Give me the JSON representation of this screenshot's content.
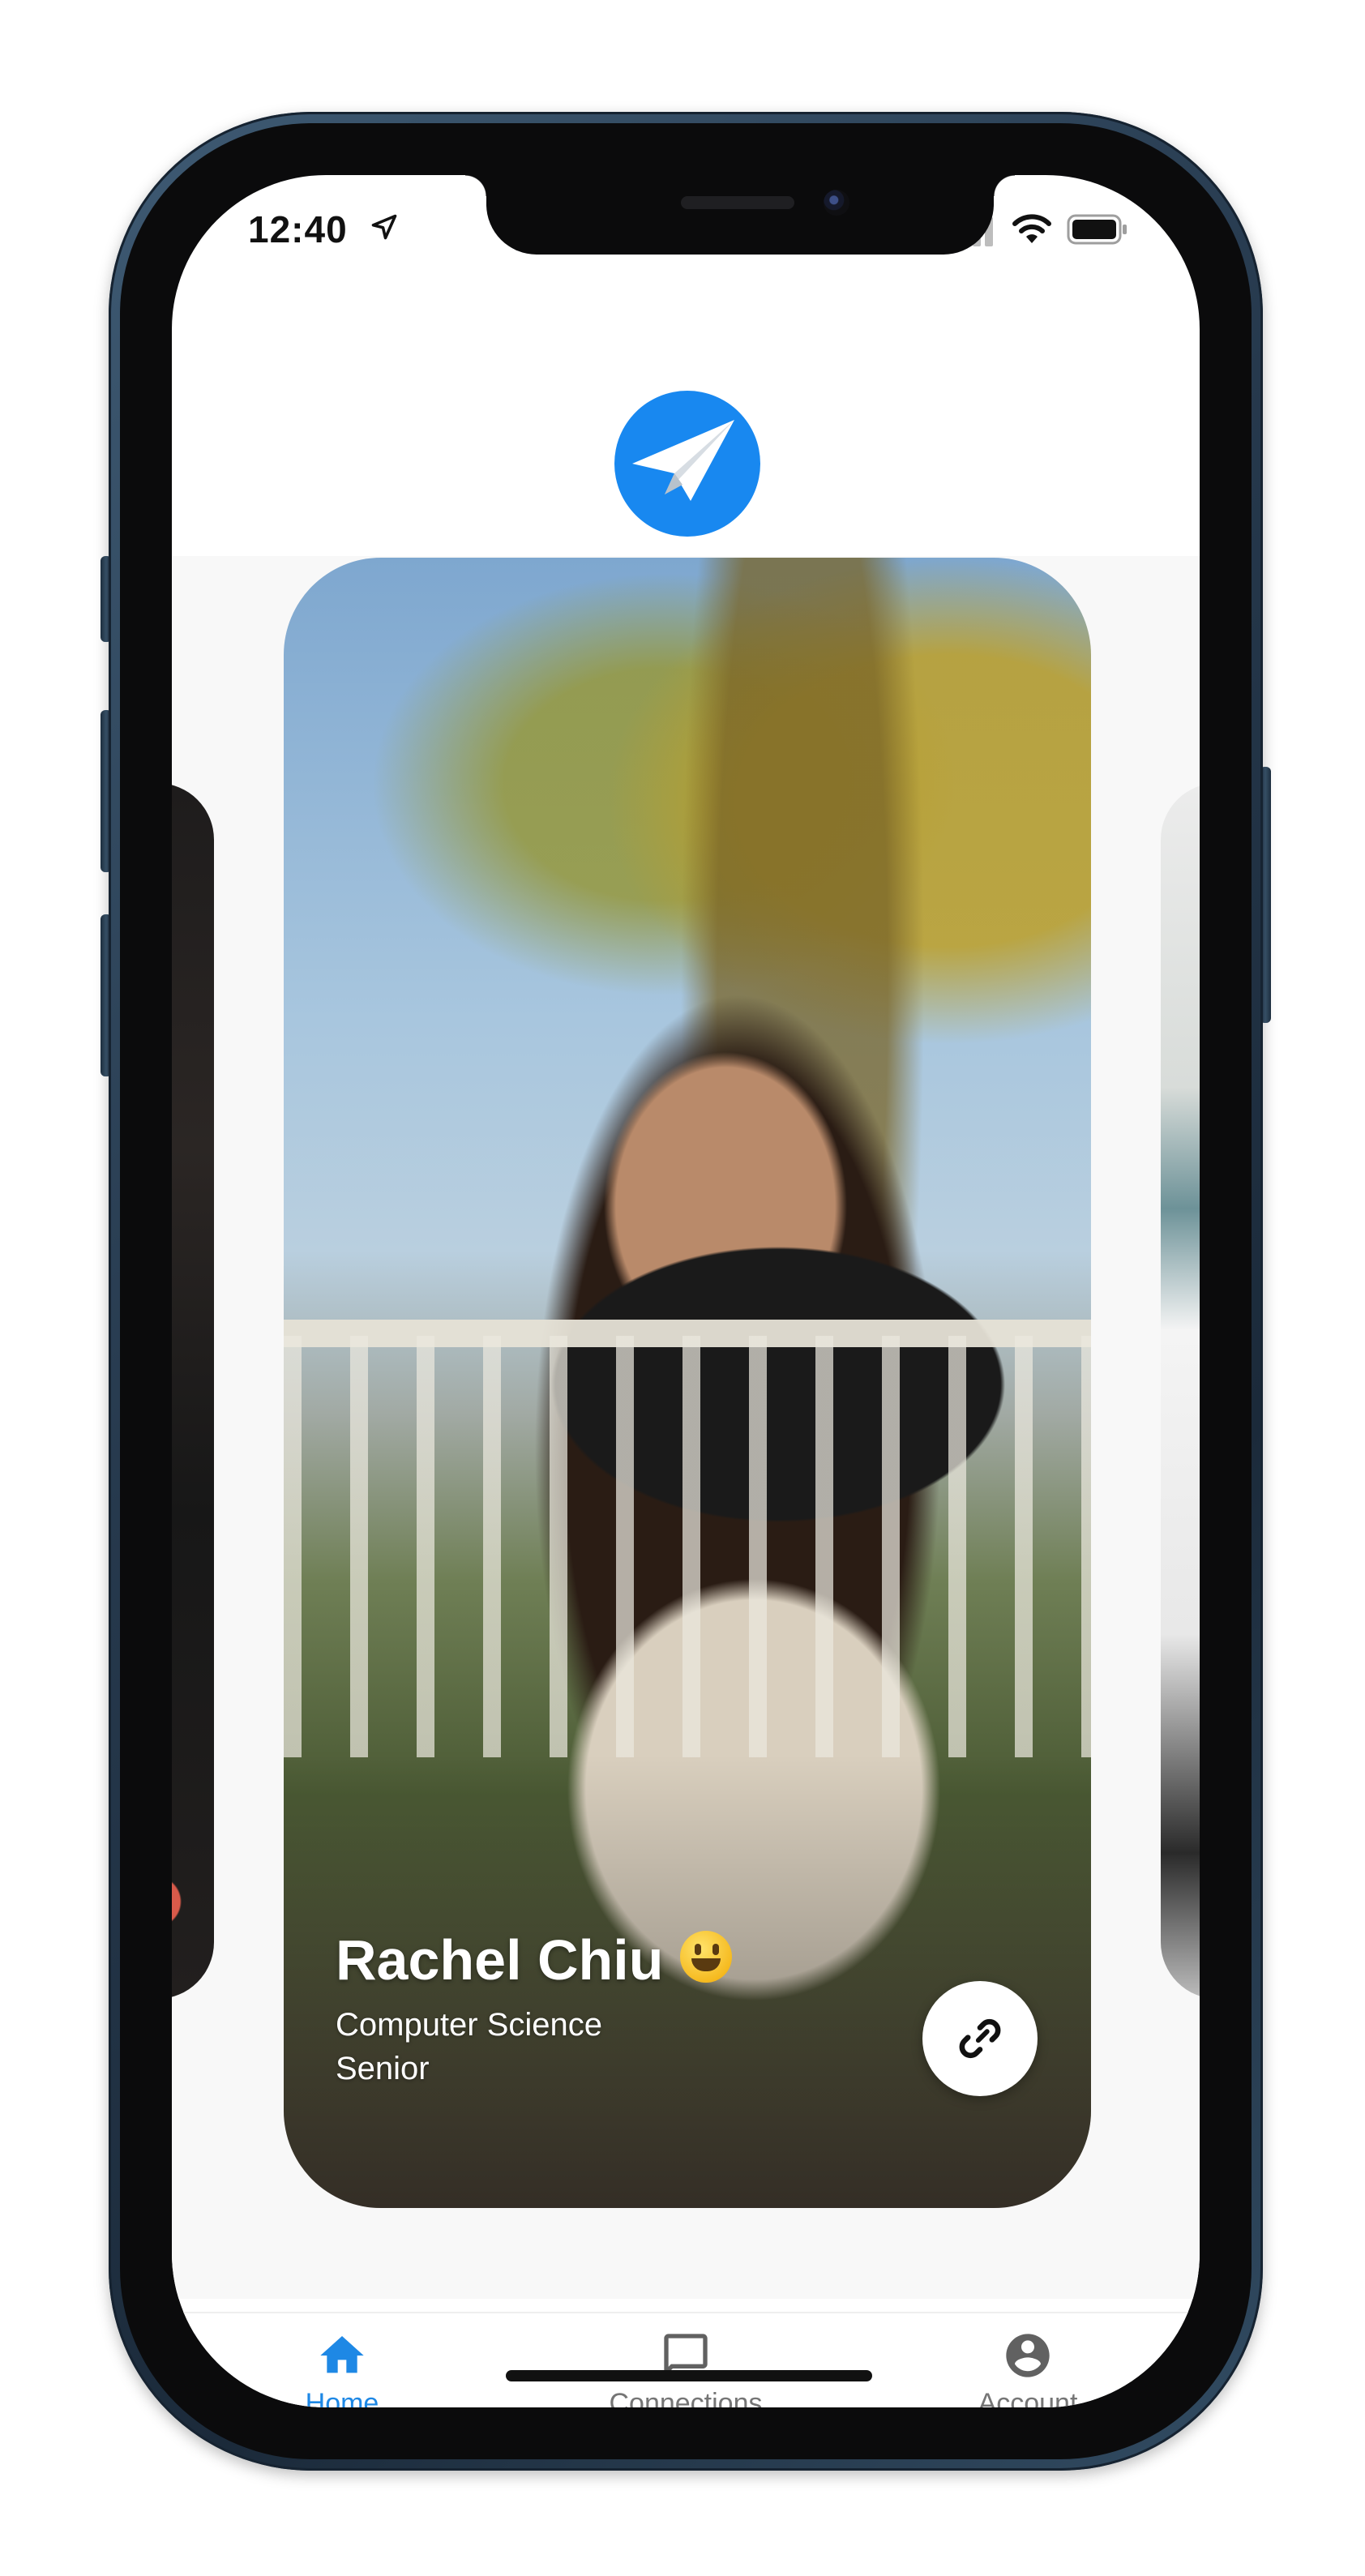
{
  "status_bar": {
    "time": "12:40"
  },
  "header": {
    "logo_icon": "paper-plane-icon",
    "accent": "#1888f0"
  },
  "carousel": {
    "active_card": {
      "name": "Rachel Chiu",
      "name_emoji": "grinning-face-emoji",
      "major": "Computer Science",
      "year": "Senior",
      "action_icon": "link-icon"
    }
  },
  "bottom_nav": {
    "active_color": "#1e88e5",
    "inactive_color": "#757575",
    "items": [
      {
        "label": "Home",
        "icon": "home-icon",
        "active": true
      },
      {
        "label": "Connections",
        "icon": "chat-bubble-icon",
        "active": false
      },
      {
        "label": "Account",
        "icon": "account-circle-icon",
        "active": false
      }
    ]
  }
}
